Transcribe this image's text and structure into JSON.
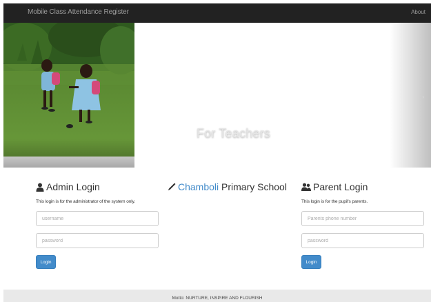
{
  "navbar": {
    "brand": "Mobile Class Attendance Register",
    "about": "About"
  },
  "carousel": {
    "caption": "For Teachers",
    "next_icon": "chevron-right-icon"
  },
  "admin": {
    "title": "Admin Login",
    "icon": "user-icon",
    "description": "This login is for the administrator of the system only.",
    "username_placeholder": "username",
    "password_placeholder": "password",
    "login_label": "Login"
  },
  "school": {
    "icon": "pencil-icon",
    "name_accent": "Chamboli",
    "name_rest": " Primary School"
  },
  "parent": {
    "title": "Parent Login",
    "icon": "users-icon",
    "description": "This login is for the pupil's parents.",
    "phone_placeholder": "Parents phone number",
    "password_placeholder": "password",
    "login_label": "Login"
  },
  "footer": {
    "motto": "Motto: NURTURE, INSPIRE AND FLOURISH"
  },
  "colors": {
    "navbar_bg": "#222222",
    "primary": "#428bca",
    "footer_bg": "#e9e9e9"
  }
}
